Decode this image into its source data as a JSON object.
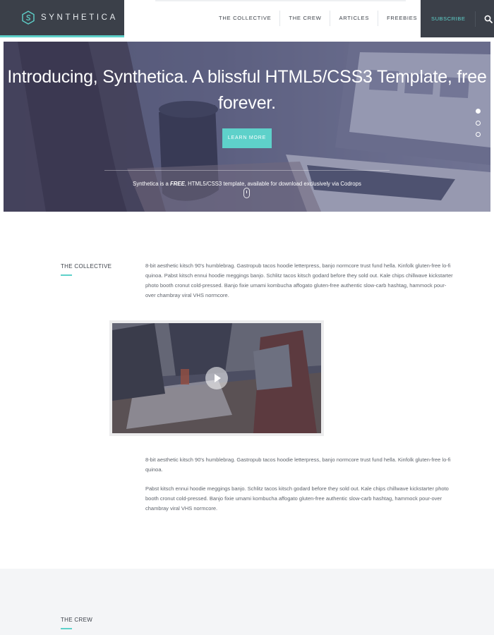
{
  "brand": {
    "name": "SYNTHETICA",
    "logo_icon": "synthetica-s-hexagon-icon",
    "accent": "#5ed1ca",
    "dark": "#3b4049"
  },
  "nav": {
    "items": [
      "THE COLLECTIVE",
      "THE CREW",
      "ARTICLES",
      "FREEBIES"
    ]
  },
  "header_utils": {
    "subscribe": "SUBSCRIBE",
    "search_icon": "search-icon"
  },
  "hero": {
    "title": "Introducing, Synthetica. A blissful HTML5/CSS3 Template, free forever.",
    "button": "LEARN MORE",
    "caption_pre": "Synthetica is a ",
    "caption_em": "FREE",
    "caption_post": ", HTML5/CSS3 template, available for download exclusively via Codrops",
    "slides_total": 3,
    "active_slide": 1
  },
  "collective": {
    "label": "THE COLLECTIVE",
    "intro": "8-bit aesthetic kitsch 90's humblebrag. Gastropub tacos hoodie letterpress, banjo normcore trust fund hella. Kinfolk gluten-free lo-fi quinoa. Pabst kitsch ennui hoodie meggings banjo. Schlitz tacos kitsch godard before they sold out. Kale chips chillwave kickstarter photo booth cronut cold-pressed. Banjo fixie umami kombucha affogato gluten-free authentic slow-carb hashtag, hammock pour-over chambray viral VHS normcore.",
    "para1": "8-bit aesthetic kitsch 90's humblebrag. Gastropub tacos hoodie letterpress, banjo normcore trust fund hella. Kinfolk gluten-free lo-fi quinoa.",
    "para2": "Pabst kitsch ennui hoodie meggings banjo. Schlitz tacos kitsch godard before they sold out. Kale chips chillwave kickstarter photo booth cronut cold-pressed. Banjo fixie umami kombucha affogato gluten-free authentic slow-carb hashtag, hammock pour-over chambray viral VHS normcore.",
    "video_icon": "play-icon"
  },
  "crew": {
    "label": "THE CREW"
  }
}
